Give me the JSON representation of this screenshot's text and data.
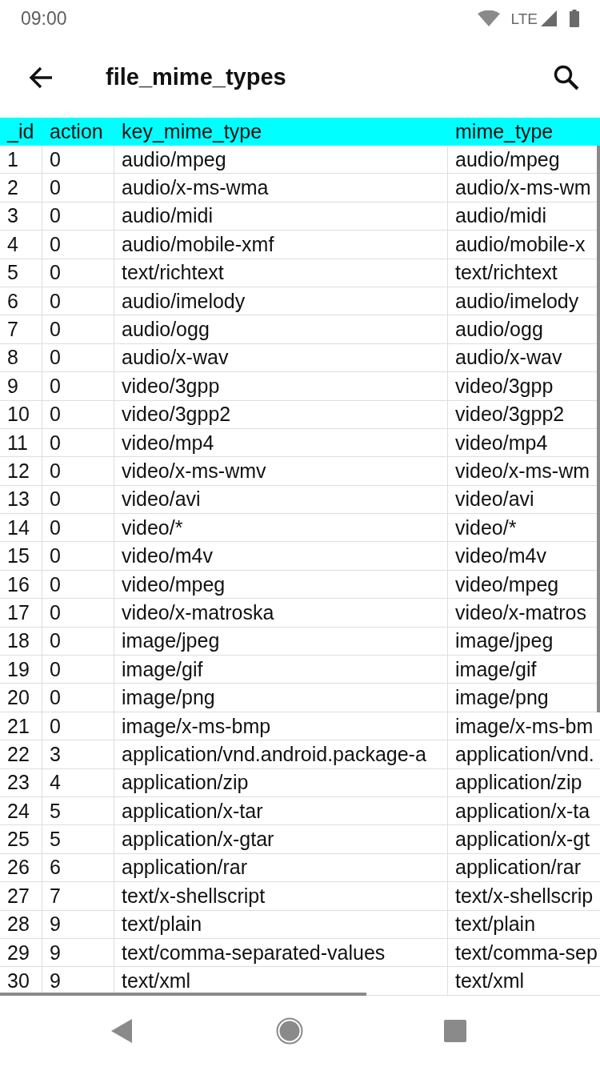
{
  "status_bar": {
    "time": "09:00",
    "network": "LTE"
  },
  "app_bar": {
    "title": "file_mime_types"
  },
  "table": {
    "columns": [
      "_id",
      "action",
      "key_mime_type",
      "mime_type"
    ],
    "rows": [
      [
        "1",
        "0",
        "audio/mpeg",
        "audio/mpeg"
      ],
      [
        "2",
        "0",
        "audio/x-ms-wma",
        "audio/x-ms-wm"
      ],
      [
        "3",
        "0",
        "audio/midi",
        "audio/midi"
      ],
      [
        "4",
        "0",
        "audio/mobile-xmf",
        "audio/mobile-x"
      ],
      [
        "5",
        "0",
        "text/richtext",
        "text/richtext"
      ],
      [
        "6",
        "0",
        "audio/imelody",
        "audio/imelody"
      ],
      [
        "7",
        "0",
        "audio/ogg",
        "audio/ogg"
      ],
      [
        "8",
        "0",
        "audio/x-wav",
        "audio/x-wav"
      ],
      [
        "9",
        "0",
        "video/3gpp",
        "video/3gpp"
      ],
      [
        "10",
        "0",
        "video/3gpp2",
        "video/3gpp2"
      ],
      [
        "11",
        "0",
        "video/mp4",
        "video/mp4"
      ],
      [
        "12",
        "0",
        "video/x-ms-wmv",
        "video/x-ms-wm"
      ],
      [
        "13",
        "0",
        "video/avi",
        "video/avi"
      ],
      [
        "14",
        "0",
        "video/*",
        "video/*"
      ],
      [
        "15",
        "0",
        "video/m4v",
        "video/m4v"
      ],
      [
        "16",
        "0",
        "video/mpeg",
        "video/mpeg"
      ],
      [
        "17",
        "0",
        "video/x-matroska",
        "video/x-matros"
      ],
      [
        "18",
        "0",
        "image/jpeg",
        "image/jpeg"
      ],
      [
        "19",
        "0",
        "image/gif",
        "image/gif"
      ],
      [
        "20",
        "0",
        "image/png",
        "image/png"
      ],
      [
        "21",
        "0",
        "image/x-ms-bmp",
        "image/x-ms-bm"
      ],
      [
        "22",
        "3",
        "application/vnd.android.package-a",
        "application/vnd."
      ],
      [
        "23",
        "4",
        "application/zip",
        "application/zip"
      ],
      [
        "24",
        "5",
        "application/x-tar",
        "application/x-ta"
      ],
      [
        "25",
        "5",
        "application/x-gtar",
        "application/x-gt"
      ],
      [
        "26",
        "6",
        "application/rar",
        "application/rar"
      ],
      [
        "27",
        "7",
        "text/x-shellscript",
        "text/x-shellscrip"
      ],
      [
        "28",
        "9",
        "text/plain",
        "text/plain"
      ],
      [
        "29",
        "9",
        "text/comma-separated-values",
        "text/comma-sep"
      ],
      [
        "30",
        "9",
        "text/xml",
        "text/xml"
      ]
    ]
  }
}
